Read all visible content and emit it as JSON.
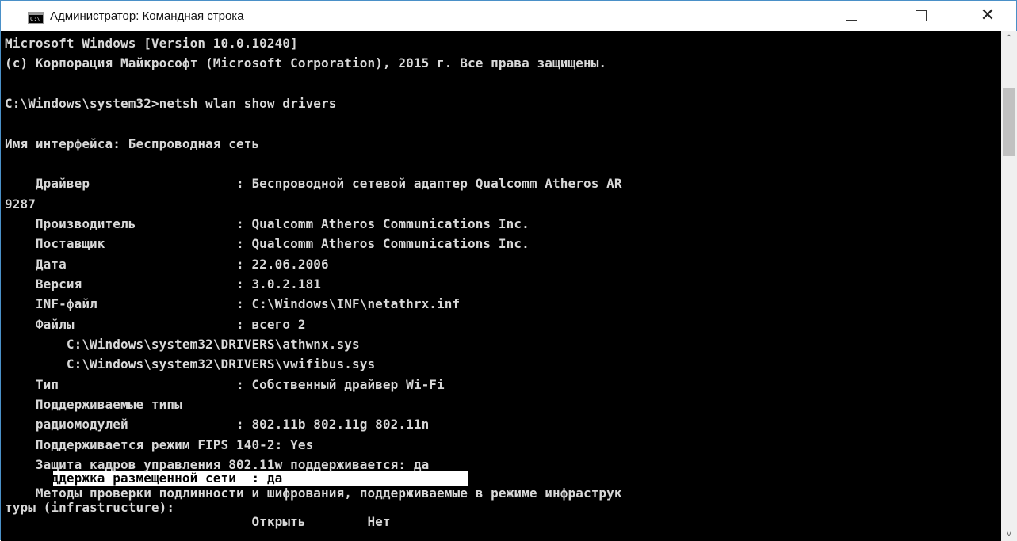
{
  "window": {
    "title": "Администратор: Командная строка",
    "icon_label": "C:\\",
    "minimize_glyph": "—",
    "maximize_glyph": "☐",
    "close_glyph": "✕"
  },
  "console": {
    "lines": [
      "Microsoft Windows [Version 10.0.10240]",
      "(c) Корпорация Майкрософт (Microsoft Corporation), 2015 г. Все права защищены.",
      "",
      "C:\\Windows\\system32>netsh wlan show drivers",
      "",
      "Имя интерфейса: Беспроводная сеть",
      "",
      "    Драйвер                   : Беспроводной сетевой адаптер Qualcomm Atheros AR",
      "9287",
      "    Производитель             : Qualcomm Atheros Communications Inc.",
      "    Поставщик                 : Qualcomm Atheros Communications Inc.",
      "    Дата                      : 22.06.2006",
      "    Версия                    : 3.0.2.181",
      "    INF-файл                  : C:\\Windows\\INF\\netathrx.inf",
      "    Файлы                     : всего 2",
      "        C:\\Windows\\system32\\DRIVERS\\athwnx.sys",
      "        C:\\Windows\\system32\\DRIVERS\\vwifibus.sys",
      "    Тип                       : Собственный драйвер Wi-Fi",
      "    Поддерживаемые типы",
      "    радиомодулей              : 802.11b 802.11g 802.11n",
      "    Поддерживается режим FIPS 140-2: Yes",
      "    Защита кадров управления 802.11w поддерживается: да",
      "    Поддержка размещенной сети  : да",
      "    Методы проверки подлинности и шифрования, поддерживаемые в режиме инфраструк",
      "туры (infrastructure):",
      "                                Открыть        Нет"
    ]
  },
  "scrollbar": {
    "up_glyph": "^",
    "down_glyph": "v"
  }
}
